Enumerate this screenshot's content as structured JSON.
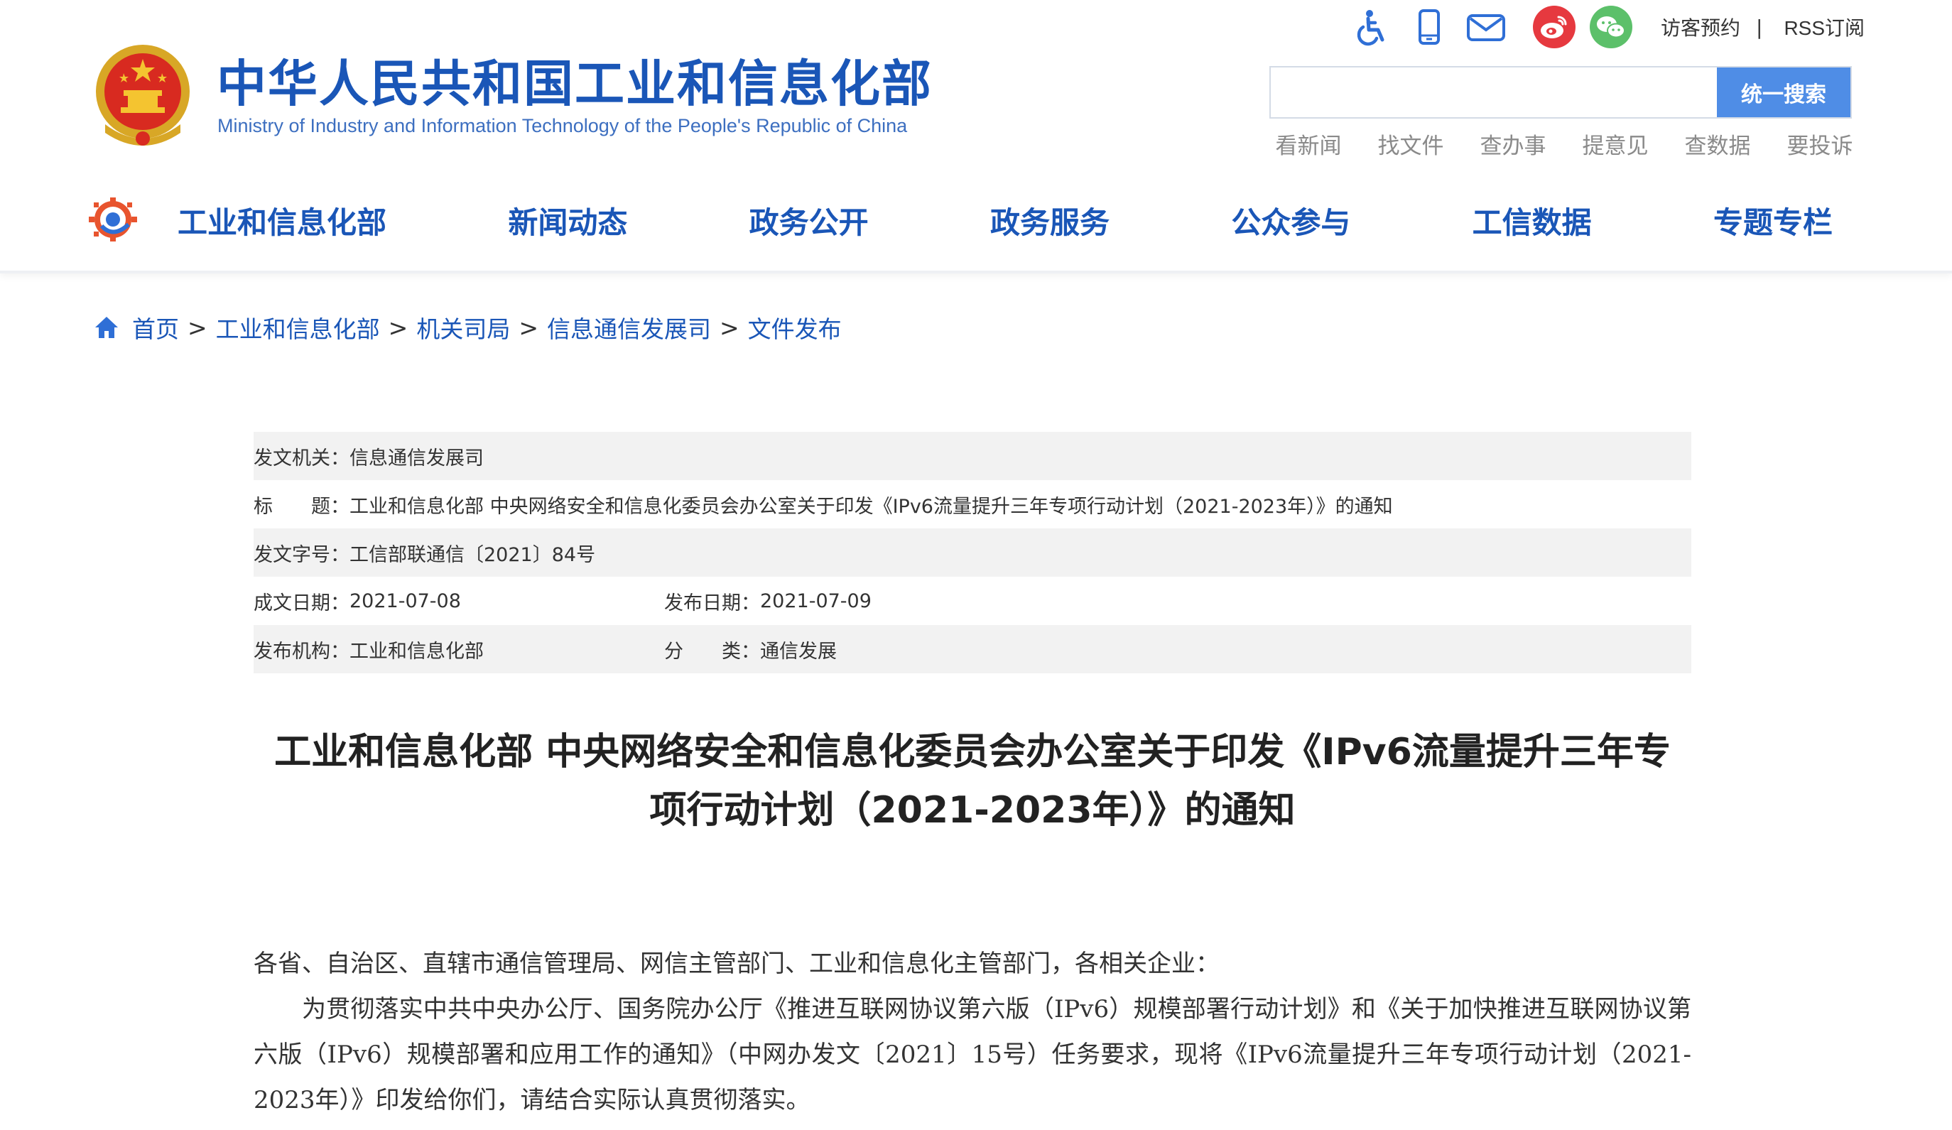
{
  "header": {
    "site_title": "中华人民共和国工业和信息化部",
    "site_subtitle": "Ministry of Industry and Information Technology of the People's Republic of China",
    "top_links": {
      "visitor": "访客预约",
      "separator": "|",
      "rss": "RSS订阅"
    },
    "top_icons": [
      "accessibility-icon",
      "mobile-icon",
      "mail-icon",
      "weibo-icon",
      "wechat-icon"
    ],
    "search": {
      "placeholder": "",
      "button_label": "统一搜索"
    },
    "quick_links": [
      "看新闻",
      "找文件",
      "查办事",
      "提意见",
      "查数据",
      "要投诉"
    ],
    "nav": [
      "工业和信息化部",
      "新闻动态",
      "政务公开",
      "政务服务",
      "公众参与",
      "工信数据",
      "专题专栏"
    ]
  },
  "breadcrumb": {
    "items": [
      "首页",
      "工业和信息化部",
      "机关司局",
      "信息通信发展司",
      "文件发布"
    ],
    "separator": ">"
  },
  "info": {
    "issuer_label": "发文机关：",
    "issuer": "信息通信发展司",
    "title_label": "标　　题：",
    "title": "工业和信息化部 中央网络安全和信息化委员会办公室关于印发《IPv6流量提升三年专项行动计划（2021-2023年）》的通知",
    "doc_no_label": "发文字号：",
    "doc_no": "工信部联通信〔2021〕84号",
    "written_label": "成文日期：",
    "written": "2021-07-08",
    "published_label": "发布日期：",
    "published": "2021-07-09",
    "org_label": "发布机构：",
    "org": "工业和信息化部",
    "category_label": "分　　类：",
    "category": "通信发展"
  },
  "document": {
    "title_line1": "工业和信息化部 中央网络安全和信息化委员会办公室关于印发《IPv6流量提升三年专",
    "title_line2": "项行动计划（2021-2023年）》的通知",
    "salutation": "各省、自治区、直辖市通信管理局、网信主管部门、工业和信息化主管部门，各相关企业：",
    "paragraph": "为贯彻落实中共中央办公厅、国务院办公厅《推进互联网协议第六版（IPv6）规模部署行动计划》和《关于加快推进互联网协议第六版（IPv6）规模部署和应用工作的通知》（中网办发文〔2021〕15号）任务要求，现将《IPv6流量提升三年专项行动计划（2021-2023年）》印发给你们，请结合实际认真贯彻落实。"
  },
  "colors": {
    "brand_blue": "#1a56b7",
    "search_button": "#4f8de6",
    "table_shade": "#f2f2f2",
    "weibo_red": "#e6393f",
    "wechat_green": "#5cc06a"
  }
}
